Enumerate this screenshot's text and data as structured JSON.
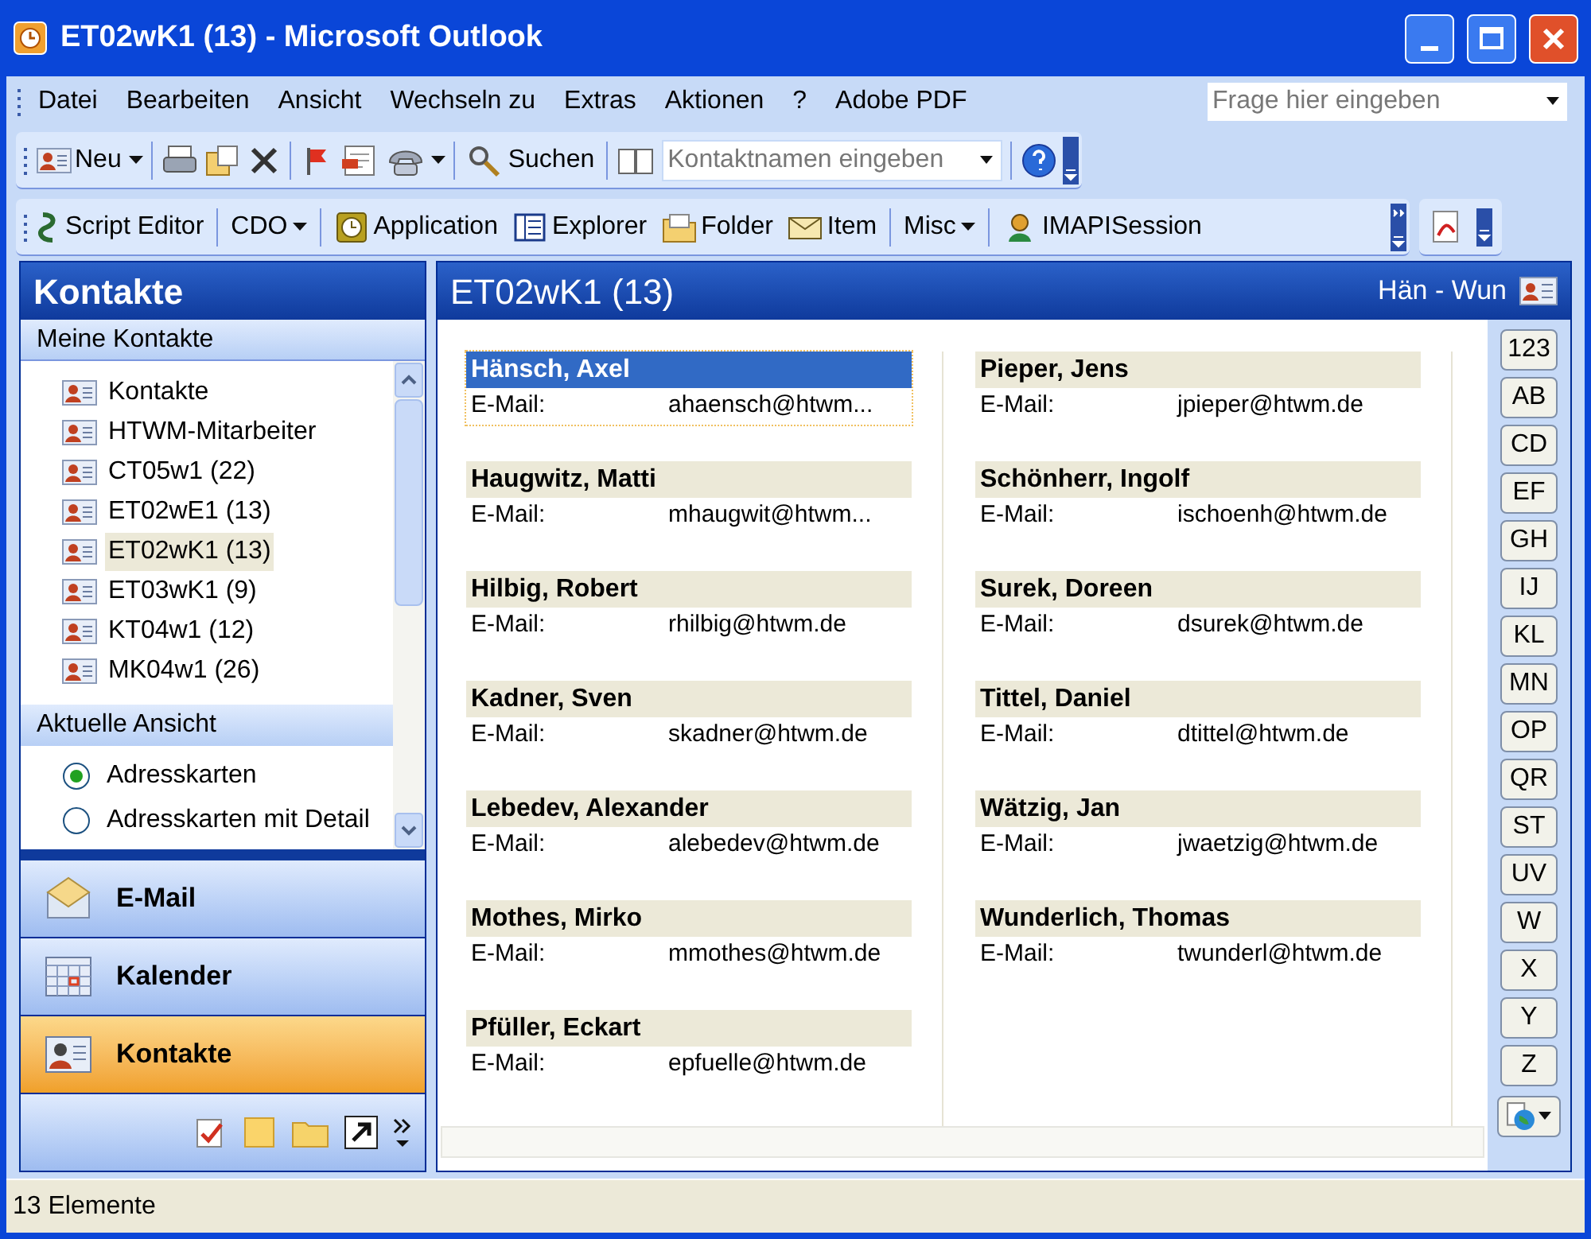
{
  "window": {
    "title": "ET02wK1 (13) - Microsoft Outlook"
  },
  "menu": [
    "Datei",
    "Bearbeiten",
    "Ansicht",
    "Wechseln zu",
    "Extras",
    "Aktionen",
    "?",
    "Adobe PDF"
  ],
  "help_field": {
    "placeholder": "Frage hier eingeben"
  },
  "standard_toolbar": {
    "new": "Neu",
    "find": "Suchen",
    "contact_field": {
      "placeholder": "Kontaktnamen eingeben"
    }
  },
  "custom_toolbar": [
    {
      "kind": "icon",
      "label": "Script Editor"
    },
    {
      "kind": "menu",
      "label": "CDO"
    },
    {
      "kind": "icon",
      "label": "Application"
    },
    {
      "kind": "icon",
      "label": "Explorer"
    },
    {
      "kind": "icon",
      "label": "Folder"
    },
    {
      "kind": "icon",
      "label": "Item"
    },
    {
      "kind": "menu",
      "label": "Misc"
    },
    {
      "kind": "icon",
      "label": "IMAPISession"
    }
  ],
  "navigation": {
    "title": "Kontakte",
    "folders_header": "Meine Kontakte",
    "folders": [
      {
        "label": "Kontakte",
        "selected": false
      },
      {
        "label": "HTWM-Mitarbeiter",
        "selected": false
      },
      {
        "label": "CT05w1 (22)",
        "selected": false
      },
      {
        "label": "ET02wE1 (13)",
        "selected": false
      },
      {
        "label": "ET02wK1 (13)",
        "selected": true
      },
      {
        "label": "ET03wK1 (9)",
        "selected": false
      },
      {
        "label": "KT04w1 (12)",
        "selected": false
      },
      {
        "label": "MK04w1 (26)",
        "selected": false
      }
    ],
    "view_header": "Aktuelle Ansicht",
    "views": [
      {
        "label": "Adresskarten",
        "selected": true
      },
      {
        "label": "Adresskarten mit Detail",
        "selected": false
      }
    ],
    "buttons": [
      {
        "kind": "mail",
        "label": "E-Mail",
        "selected": false
      },
      {
        "kind": "calendar",
        "label": "Kalender",
        "selected": false
      },
      {
        "kind": "contacts",
        "label": "Kontakte",
        "selected": true
      }
    ]
  },
  "contacts_view": {
    "title": "ET02wK1 (13)",
    "range": "Hän - Wun",
    "cards": [
      {
        "name": "Hänsch, Axel",
        "label": "E-Mail:",
        "email": "ahaensch@htwm...",
        "selected": true
      },
      {
        "name": "Haugwitz, Matti",
        "label": "E-Mail:",
        "email": "mhaugwit@htwm...",
        "selected": false
      },
      {
        "name": "Hilbig, Robert",
        "label": "E-Mail:",
        "email": "rhilbig@htwm.de",
        "selected": false
      },
      {
        "name": "Kadner, Sven",
        "label": "E-Mail:",
        "email": "skadner@htwm.de",
        "selected": false
      },
      {
        "name": "Lebedev, Alexander",
        "label": "E-Mail:",
        "email": "alebedev@htwm.de",
        "selected": false
      },
      {
        "name": "Mothes, Mirko",
        "label": "E-Mail:",
        "email": "mmothes@htwm.de",
        "selected": false
      },
      {
        "name": "Pfüller, Eckart",
        "label": "E-Mail:",
        "email": "epfuelle@htwm.de",
        "selected": false
      },
      {
        "name": "Pieper, Jens",
        "label": "E-Mail:",
        "email": "jpieper@htwm.de",
        "selected": false
      },
      {
        "name": "Schönherr, Ingolf",
        "label": "E-Mail:",
        "email": "ischoenh@htwm.de",
        "selected": false
      },
      {
        "name": "Surek, Doreen",
        "label": "E-Mail:",
        "email": "dsurek@htwm.de",
        "selected": false
      },
      {
        "name": "Tittel, Daniel",
        "label": "E-Mail:",
        "email": "dtittel@htwm.de",
        "selected": false
      },
      {
        "name": "Wätzig, Jan",
        "label": "E-Mail:",
        "email": "jwaetzig@htwm.de",
        "selected": false
      },
      {
        "name": "Wunderlich, Thomas",
        "label": "E-Mail:",
        "email": "twunderl@htwm.de",
        "selected": false
      }
    ],
    "letters": [
      "123",
      "AB",
      "CD",
      "EF",
      "GH",
      "IJ",
      "KL",
      "MN",
      "OP",
      "QR",
      "ST",
      "UV",
      "W",
      "X",
      "Y",
      "Z"
    ]
  },
  "status_bar": "13 Elemente"
}
